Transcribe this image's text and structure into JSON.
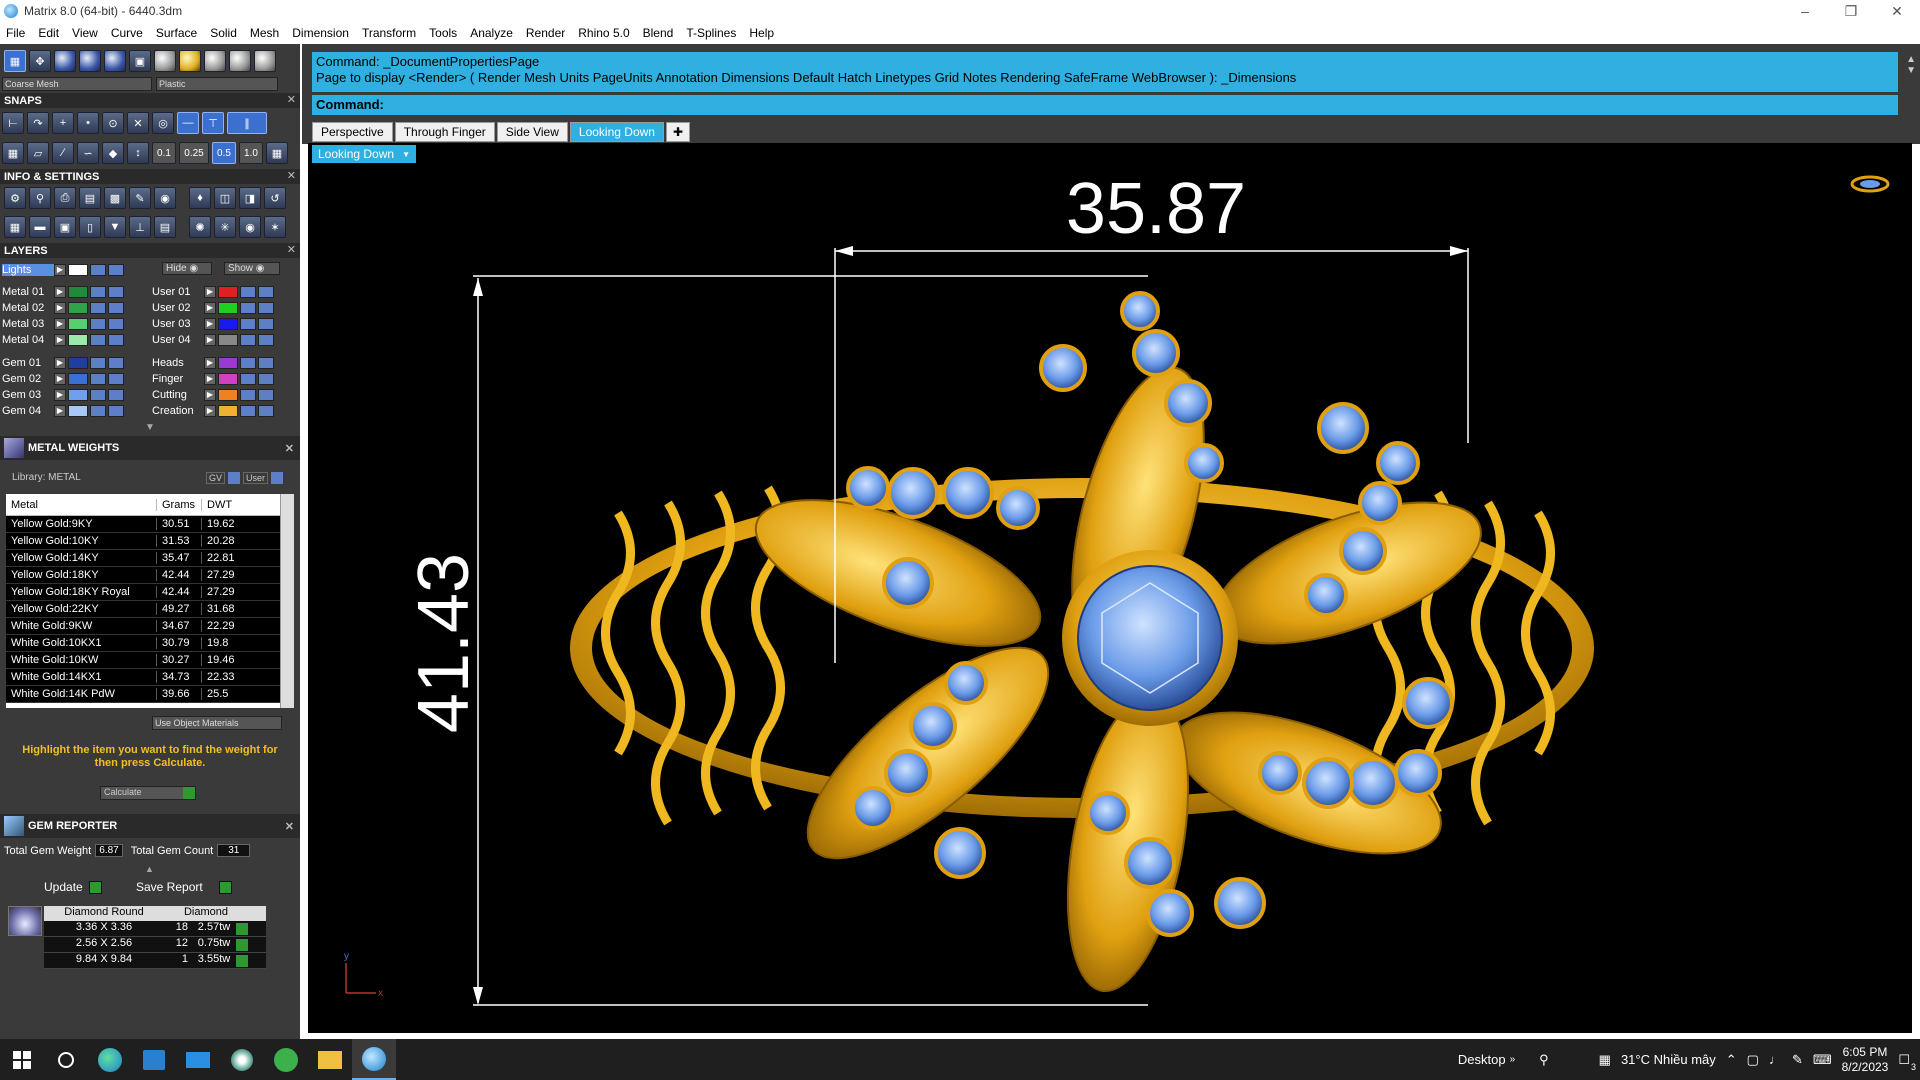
{
  "window": {
    "title": "Matrix 8.0 (64-bit) - 6440.3dm"
  },
  "menu": [
    "File",
    "Edit",
    "View",
    "Curve",
    "Surface",
    "Solid",
    "Mesh",
    "Dimension",
    "Transform",
    "Tools",
    "Analyze",
    "Render",
    "Rhino 5.0",
    "Blend",
    "T-Splines",
    "Help"
  ],
  "left": {
    "mesh_combo": "Coarse Mesh",
    "material_combo": "Plastic",
    "snaps_title": "SNAPS",
    "snap_values": [
      "0.1",
      "0.25",
      "0.5",
      "1.0"
    ],
    "info_title": "INFO & SETTINGS",
    "layers_title": "LAYERS",
    "lights": "Lights",
    "hide": "Hide",
    "show": "Show",
    "layers_left": [
      {
        "name": "Metal 01",
        "color": "#1f8a3a"
      },
      {
        "name": "Metal 02",
        "color": "#2fa34a"
      },
      {
        "name": "Metal 03",
        "color": "#54d070"
      },
      {
        "name": "Metal 04",
        "color": "#9ce8a8"
      },
      {
        "name": "Gem 01",
        "color": "#1c3fa0"
      },
      {
        "name": "Gem 02",
        "color": "#3a6fd8"
      },
      {
        "name": "Gem 03",
        "color": "#6fa0f0"
      },
      {
        "name": "Gem 04",
        "color": "#a8c8f8"
      }
    ],
    "layers_right": [
      {
        "name": "User 01",
        "color": "#e02020"
      },
      {
        "name": "User 02",
        "color": "#20d020"
      },
      {
        "name": "User 03",
        "color": "#1a1af0"
      },
      {
        "name": "User 04",
        "color": "#888888"
      },
      {
        "name": "Heads",
        "color": "#9a3ad0"
      },
      {
        "name": "Finger",
        "color": "#d040c0"
      },
      {
        "name": "Cutting",
        "color": "#f08020"
      },
      {
        "name": "Creation",
        "color": "#f0b030"
      }
    ],
    "metal_weights_title": "METAL WEIGHTS",
    "library": "Library: METAL",
    "gv_label": "GV",
    "user_label": "User",
    "mw_headers": [
      "Metal",
      "Grams",
      "DWT"
    ],
    "mw_rows": [
      [
        "Yellow Gold:9KY",
        "30.51",
        "19.62"
      ],
      [
        "Yellow Gold:10KY",
        "31.53",
        "20.28"
      ],
      [
        "Yellow Gold:14KY",
        "35.47",
        "22.81"
      ],
      [
        "Yellow Gold:18KY",
        "42.44",
        "27.29"
      ],
      [
        "Yellow Gold:18KY Royal",
        "42.44",
        "27.29"
      ],
      [
        "Yellow Gold:22KY",
        "49.27",
        "31.68"
      ],
      [
        "White Gold:9KW",
        "34.67",
        "22.29"
      ],
      [
        "White Gold:10KX1",
        "30.79",
        "19.8"
      ],
      [
        "White Gold:10KW",
        "30.27",
        "19.46"
      ],
      [
        "White Gold:14KX1",
        "34.73",
        "22.33"
      ],
      [
        "White Gold:14K PdW",
        "39.66",
        "25.5"
      ]
    ],
    "use_object_materials": "Use Object Materials",
    "highlight_text": "Highlight the item you want to find the weight for then press Calculate.",
    "calculate": "Calculate",
    "gem_reporter_title": "GEM REPORTER",
    "total_gem_weight_label": "Total Gem Weight",
    "total_gem_weight": "6.87",
    "total_gem_count_label": "Total Gem Count",
    "total_gem_count": "31",
    "update": "Update",
    "save_report": "Save Report",
    "gem_headers": [
      "Diamond Round",
      "Diamond"
    ],
    "gem_rows": [
      [
        "3.36 X 3.36",
        "18",
        "2.57tw"
      ],
      [
        "2.56 X 2.56",
        "12",
        "0.75tw"
      ],
      [
        "9.84 X 9.84",
        "1",
        "3.55tw"
      ]
    ]
  },
  "command": {
    "line1": "Command: _DocumentPropertiesPage",
    "line2": "Page to display <Render> ( Render  Mesh  Units  PageUnits  Annotation  Dimensions  Default  Hatch  Linetypes  Grid  Notes  Rendering  SafeFrame  WebBrowser ): _Dimensions",
    "prompt": "Command:"
  },
  "tabs": [
    "Perspective",
    "Through Finger",
    "Side View",
    "Looking Down"
  ],
  "active_tab": "Looking Down",
  "viewport": {
    "label": "Looking Down",
    "dim_width": "35.87",
    "dim_height": "41.43",
    "axis_y": "y",
    "axis_x": "x"
  },
  "taskbar": {
    "desktop": "Desktop",
    "weather": "31°C  Nhiều mây",
    "time": "6:05 PM",
    "date": "8/2/2023",
    "notif": "3"
  }
}
